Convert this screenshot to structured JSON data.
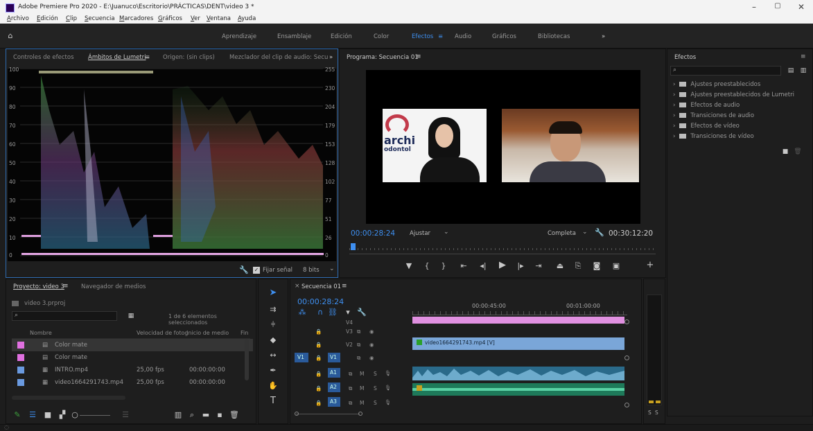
{
  "window": {
    "title": "Adobe Premiere Pro 2020 - E:\\Juanuco\\Escritorio\\PRÁCTICAS\\DENT\\video 3 *",
    "minimize": "–",
    "maximize": "▢",
    "close": "✕"
  },
  "menu": [
    "Archivo",
    "Edición",
    "Clip",
    "Secuencia",
    "Marcadores",
    "Gráficos",
    "Ver",
    "Ventana",
    "Ayuda"
  ],
  "workspaces": {
    "items": [
      "Aprendizaje",
      "Ensamblaje",
      "Edición",
      "Color",
      "Efectos",
      "Audio",
      "Gráficos",
      "Bibliotecas"
    ],
    "active": "Efectos",
    "menu_glyph": "≡",
    "more": "»"
  },
  "scopes_panel": {
    "tabs": [
      "Controles de efectos",
      "Ámbitos de Lumetri",
      "Origen: (sin clips)",
      "Mezclador del clip de audio: Secu"
    ],
    "active_tab": "Ámbitos de Lumetri",
    "tab_menu": "≡",
    "more": "»",
    "left_scale": [
      "100",
      "90",
      "80",
      "70",
      "60",
      "50",
      "40",
      "30",
      "20",
      "10",
      "0"
    ],
    "right_scale": [
      "255",
      "230",
      "204",
      "179",
      "153",
      "128",
      "102",
      "77",
      "51",
      "26",
      "0"
    ],
    "fijar_senal": "Fijar señal",
    "bits": "8 bits"
  },
  "program_monitor": {
    "title": "Programa: Secuencia 01",
    "menu": "≡",
    "timecode": "00:00:28:24",
    "fit": "Ajustar",
    "quality": "Completa",
    "duration": "00:30:12:20",
    "video_text_left": "archi",
    "video_text_left2": "odontol"
  },
  "project_panel": {
    "tabs": [
      "Proyecto: video 3",
      "Navegador de medios"
    ],
    "tab_menu": "≡",
    "project_file": "video 3.prproj",
    "selection_info": "1 de 6 elementos seleccionados",
    "columns": [
      "Nombre",
      "Velocidad de fotog",
      "Inicio de medio",
      "Fin"
    ],
    "rows": [
      {
        "name": "Color mate",
        "fps": "",
        "start": "",
        "color": "#e070e0",
        "selected": true
      },
      {
        "name": "Color mate",
        "fps": "",
        "start": "",
        "color": "#e070e0",
        "selected": false
      },
      {
        "name": "INTRO.mp4",
        "fps": "25,00 fps",
        "start": "00:00:00:00",
        "color": "#6a9ae0",
        "selected": false
      },
      {
        "name": "video1664291743.mp4",
        "fps": "25,00 fps",
        "start": "00:00:00:00",
        "color": "#6a9ae0",
        "selected": false
      }
    ]
  },
  "timeline": {
    "tab": "Secuencia 01",
    "close": "×",
    "menu": "≡",
    "timecode": "00:00:28:24",
    "ruler": [
      "00:00:45:00",
      "00:01:00:00"
    ],
    "video_tracks": [
      "V4",
      "V3",
      "V2",
      "V1"
    ],
    "audio_tracks": [
      "A1",
      "A2",
      "A3"
    ],
    "track_toggles": [
      "M",
      "S"
    ],
    "clip_v2": "video1664291743.mp4 [V]",
    "source_patch": "V1"
  },
  "effects_panel": {
    "title": "Efectos",
    "menu": "≡",
    "items": [
      "Ajustes preestablecidos",
      "Ajustes preestablecidos de Lumetri",
      "Efectos de audio",
      "Transiciones de audio",
      "Efectos de vídeo",
      "Transiciones de vídeo"
    ]
  },
  "audio_meter": {
    "labels": [
      "S",
      "S"
    ]
  },
  "colors": {
    "accent": "#3e8ff0",
    "pink_clip": "#e090e0",
    "video_clip": "#7aa6d8",
    "audio_clip": "#2a8a7a",
    "audio_clip2": "#20a070"
  }
}
